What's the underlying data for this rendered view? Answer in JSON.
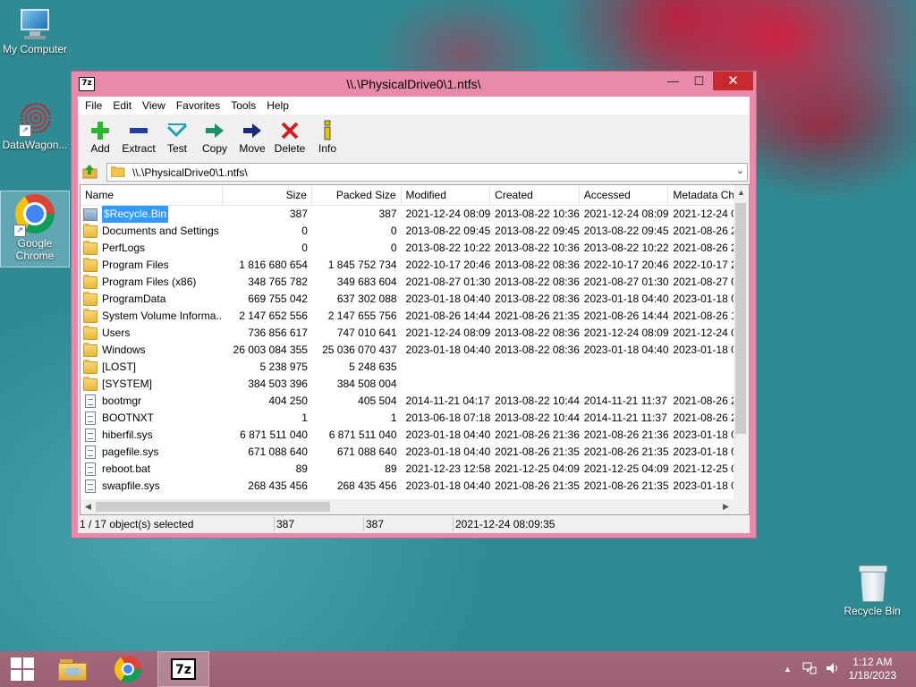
{
  "desktop": {
    "icons": [
      {
        "label": "My Computer"
      },
      {
        "label": "DataWagon..."
      },
      {
        "label_line1": "Google",
        "label_line2": "Chrome"
      },
      {
        "label": "Recycle Bin"
      }
    ]
  },
  "window": {
    "title": "\\\\.\\PhysicalDrive0\\1.ntfs\\",
    "app_icon_text": "7z",
    "buttons": {
      "minimize": "—",
      "maximize": "☐",
      "close": "✕"
    }
  },
  "menu": [
    "File",
    "Edit",
    "View",
    "Favorites",
    "Tools",
    "Help"
  ],
  "toolbar": [
    {
      "label": "Add",
      "icon": "plus-icon",
      "color": "#2bb52b"
    },
    {
      "label": "Extract",
      "icon": "minus-icon",
      "color": "#1f3fa8"
    },
    {
      "label": "Test",
      "icon": "check-icon",
      "color": "#1aa3b5"
    },
    {
      "label": "Copy",
      "icon": "copy-arrow-icon",
      "color": "#1f8f6a"
    },
    {
      "label": "Move",
      "icon": "move-arrow-icon",
      "color": "#1b2a7a"
    },
    {
      "label": "Delete",
      "icon": "x-icon",
      "color": "#d22020"
    },
    {
      "label": "Info",
      "icon": "info-icon",
      "color": "#e0c800"
    }
  ],
  "address": {
    "path": "\\\\.\\PhysicalDrive0\\1.ntfs\\"
  },
  "columns": [
    "Name",
    "Size",
    "Packed Size",
    "Modified",
    "Created",
    "Accessed",
    "Metadata Ch"
  ],
  "rows": [
    {
      "name": "$Recycle.Bin",
      "type": "bin",
      "size": "387",
      "packed": "387",
      "modified": "2021-12-24 08:09",
      "created": "2013-08-22 10:36",
      "accessed": "2021-12-24 08:09",
      "meta": "2021-12-24 0",
      "selected": true
    },
    {
      "name": "Documents and Settings",
      "type": "folder",
      "size": "0",
      "packed": "0",
      "modified": "2013-08-22 09:45",
      "created": "2013-08-22 09:45",
      "accessed": "2013-08-22 09:45",
      "meta": "2021-08-26 2"
    },
    {
      "name": "PerfLogs",
      "type": "folder",
      "size": "0",
      "packed": "0",
      "modified": "2013-08-22 10:22",
      "created": "2013-08-22 10:36",
      "accessed": "2013-08-22 10:22",
      "meta": "2021-08-26 2"
    },
    {
      "name": "Program Files",
      "type": "folder",
      "size": "1 816 680 654",
      "packed": "1 845 752 734",
      "modified": "2022-10-17 20:46",
      "created": "2013-08-22 08:36",
      "accessed": "2022-10-17 20:46",
      "meta": "2022-10-17 2"
    },
    {
      "name": "Program Files (x86)",
      "type": "folder",
      "size": "348 765 782",
      "packed": "349 683 604",
      "modified": "2021-08-27 01:30",
      "created": "2013-08-22 08:36",
      "accessed": "2021-08-27 01:30",
      "meta": "2021-08-27 0"
    },
    {
      "name": "ProgramData",
      "type": "folder",
      "size": "669 755 042",
      "packed": "637 302 088",
      "modified": "2023-01-18 04:40",
      "created": "2013-08-22 08:36",
      "accessed": "2023-01-18 04:40",
      "meta": "2023-01-18 0"
    },
    {
      "name": "System Volume Informa...",
      "type": "folder",
      "size": "2 147 652 556",
      "packed": "2 147 655 756",
      "modified": "2021-08-26 14:44",
      "created": "2021-08-26 21:35",
      "accessed": "2021-08-26 14:44",
      "meta": "2021-08-26 1"
    },
    {
      "name": "Users",
      "type": "folder",
      "size": "736 856 617",
      "packed": "747 010 641",
      "modified": "2021-12-24 08:09",
      "created": "2013-08-22 08:36",
      "accessed": "2021-12-24 08:09",
      "meta": "2021-12-24 0"
    },
    {
      "name": "Windows",
      "type": "folder",
      "size": "26 003 084 355",
      "packed": "25 036 070 437",
      "modified": "2023-01-18 04:40",
      "created": "2013-08-22 08:36",
      "accessed": "2023-01-18 04:40",
      "meta": "2023-01-18 0"
    },
    {
      "name": "[LOST]",
      "type": "folder",
      "size": "5 238 975",
      "packed": "5 248 635",
      "modified": "",
      "created": "",
      "accessed": "",
      "meta": ""
    },
    {
      "name": "[SYSTEM]",
      "type": "folder",
      "size": "384 503 396",
      "packed": "384 508 004",
      "modified": "",
      "created": "",
      "accessed": "",
      "meta": ""
    },
    {
      "name": "bootmgr",
      "type": "file",
      "size": "404 250",
      "packed": "405 504",
      "modified": "2014-11-21 04:17",
      "created": "2013-08-22 10:44",
      "accessed": "2014-11-21 11:37",
      "meta": "2021-08-26 2"
    },
    {
      "name": "BOOTNXT",
      "type": "file",
      "size": "1",
      "packed": "1",
      "modified": "2013-06-18 07:18",
      "created": "2013-08-22 10:44",
      "accessed": "2014-11-21 11:37",
      "meta": "2021-08-26 2"
    },
    {
      "name": "hiberfil.sys",
      "type": "file",
      "size": "6 871 511 040",
      "packed": "6 871 511 040",
      "modified": "2023-01-18 04:40",
      "created": "2021-08-26 21:36",
      "accessed": "2021-08-26 21:36",
      "meta": "2023-01-18 0"
    },
    {
      "name": "pagefile.sys",
      "type": "file",
      "size": "671 088 640",
      "packed": "671 088 640",
      "modified": "2023-01-18 04:40",
      "created": "2021-08-26 21:35",
      "accessed": "2021-08-26 21:35",
      "meta": "2023-01-18 0"
    },
    {
      "name": "reboot.bat",
      "type": "file",
      "size": "89",
      "packed": "89",
      "modified": "2021-12-23 12:58",
      "created": "2021-12-25 04:09",
      "accessed": "2021-12-25 04:09",
      "meta": "2021-12-25 0"
    },
    {
      "name": "swapfile.sys",
      "type": "file",
      "size": "268 435 456",
      "packed": "268 435 456",
      "modified": "2023-01-18 04:40",
      "created": "2021-08-26 21:35",
      "accessed": "2021-08-26 21:35",
      "meta": "2023-01-18 0"
    }
  ],
  "status": {
    "selection": "1 / 17 object(s) selected",
    "size": "387",
    "packed": "387",
    "modified": "2021-12-24 08:09:35"
  },
  "taskbar": {
    "clock_time": "1:12 AM",
    "clock_date": "1/18/2023",
    "active_app": "7z",
    "accent": "#9e6378"
  }
}
